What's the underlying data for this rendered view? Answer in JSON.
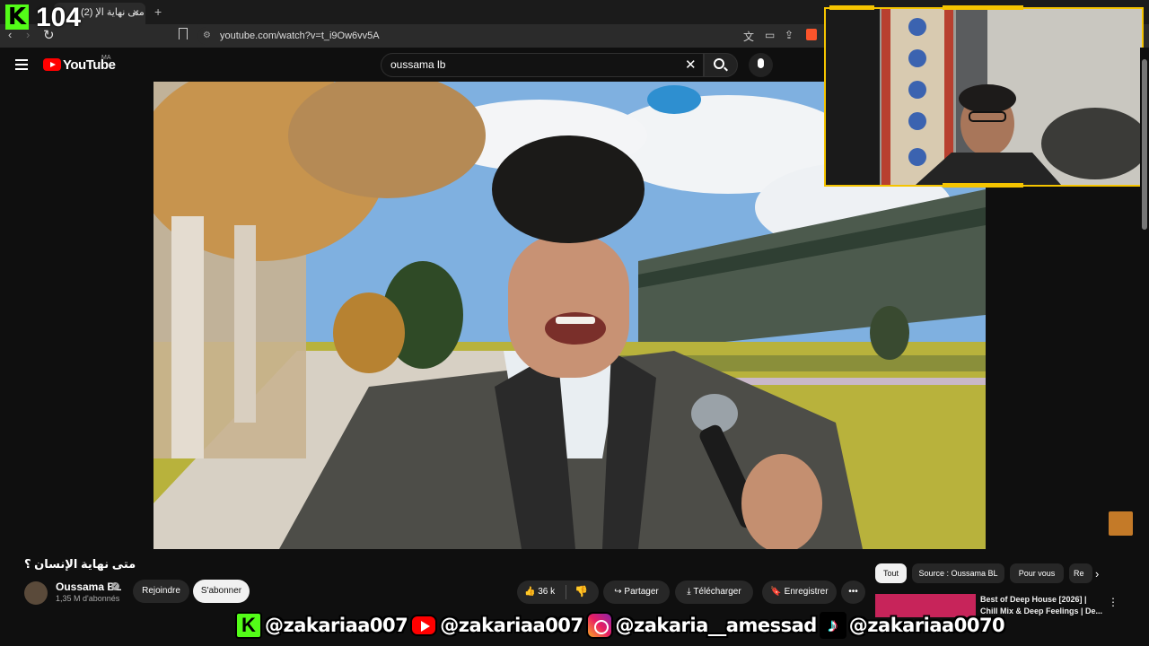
{
  "browser": {
    "tab_title": "(2) متى نهاية الإ",
    "tab_close": "×",
    "new_tab": "+",
    "url": "youtube.com/watch?v=t_i9Ow6vv5A"
  },
  "overlay": {
    "logo": "K",
    "count": "104"
  },
  "header": {
    "logo_text": "YouTube",
    "country_code": "MA",
    "search_value": "oussama lb",
    "clear_icon": "✕"
  },
  "video": {
    "title": "متى نهاية الإنسان ؟",
    "channel_name": "Oussama BL",
    "subscribers": "1,35 M d'abonnés",
    "join_label": "Rejoindre",
    "subscribe_label": "S'abonner",
    "like_count": "36 k",
    "share_label": "Partager",
    "download_label": "Télécharger",
    "save_label": "Enregistrer",
    "more_label": "•••"
  },
  "chips": [
    "Tout",
    "Source : Oussama BL",
    "Pour vous",
    "Re"
  ],
  "recommendation": {
    "title": "Best of Deep House [2026] | Chill Mix & Deep Feelings | De..."
  },
  "socials": {
    "kick": "@zakariaa007",
    "youtube": "@zakariaa007",
    "instagram": "@zakaria__amessad",
    "tiktok": "@zakariaa0070"
  },
  "colors": {
    "youtube_red": "#ff0000",
    "kick_green": "#53fc18",
    "cam_frame": "#f5c400"
  }
}
